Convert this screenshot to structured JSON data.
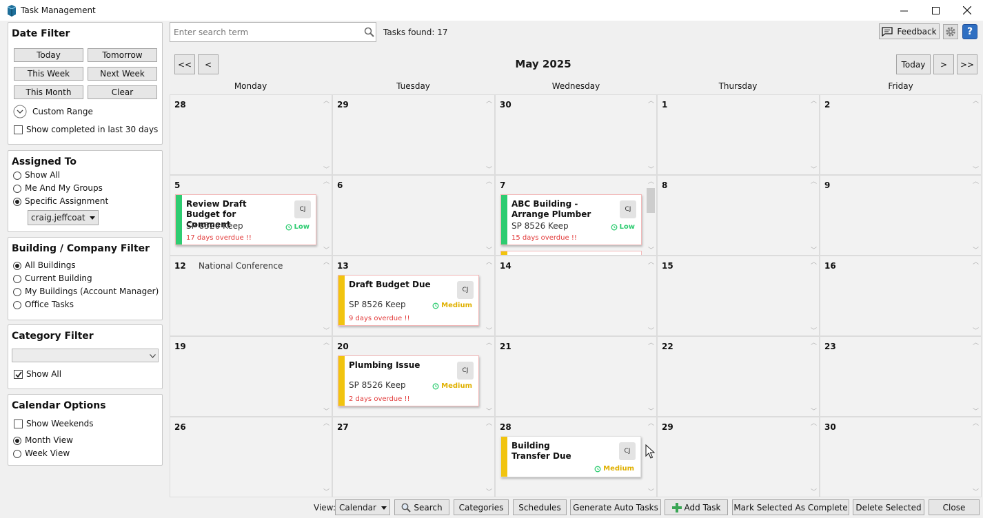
{
  "window": {
    "title": "Task Management"
  },
  "colors": {
    "low": "#2ecc71",
    "medium": "#f1c40f",
    "overdue": "#e23b3b"
  },
  "date_filter": {
    "title": "Date Filter",
    "today": "Today",
    "tomorrow": "Tomorrow",
    "this_week": "This Week",
    "next_week": "Next Week",
    "this_month": "This Month",
    "clear": "Clear",
    "custom_range": "Custom Range",
    "show_completed": "Show completed in last 30 days"
  },
  "assigned": {
    "title": "Assigned To",
    "options": [
      "Show All",
      "Me And My Groups",
      "Specific Assignment"
    ],
    "selected_user": "craig.jeffcoat"
  },
  "building": {
    "title": "Building / Company Filter",
    "options": [
      "All Buildings",
      "Current Building",
      "My Buildings (Account Manager)",
      "Office Tasks"
    ]
  },
  "category": {
    "title": "Category Filter",
    "show_all": "Show All"
  },
  "calendar_options": {
    "title": "Calendar Options",
    "show_weekends": "Show Weekends",
    "month_view": "Month View",
    "week_view": "Week View"
  },
  "search": {
    "placeholder": "Enter search term",
    "tasks_found": "Tasks found: 17"
  },
  "header": {
    "feedback": "Feedback"
  },
  "nav": {
    "first": "<<",
    "prev": "<",
    "month": "May 2025",
    "today": "Today",
    "next": ">",
    "last": ">>"
  },
  "days": [
    "Monday",
    "Tuesday",
    "Wednesday",
    "Thursday",
    "Friday"
  ],
  "weeks": [
    [
      "28",
      "29",
      "30",
      "1",
      "2"
    ],
    [
      "5",
      "6",
      "7",
      "8",
      "9"
    ],
    [
      "12",
      "13",
      "14",
      "15",
      "16"
    ],
    [
      "19",
      "20",
      "21",
      "22",
      "23"
    ],
    [
      "26",
      "27",
      "28",
      "29",
      "30"
    ]
  ],
  "holiday": "National Conference",
  "tasks": [
    {
      "title": "Review Draft Budget for Comment",
      "location": "SP 8526 Keep",
      "overdue": "17 days overdue !!",
      "assignee": "CJ",
      "priority": "Low"
    },
    {
      "title": "ABC Building - Arrange Plumber",
      "location": "SP 8526 Keep",
      "overdue": "15 days overdue !!",
      "assignee": "CJ",
      "priority": "Low"
    },
    {
      "title": "Draft Budget Due",
      "location": "SP 8526 Keep",
      "overdue": "9 days overdue !!",
      "assignee": "CJ",
      "priority": "Medium"
    },
    {
      "title": "Plumbing Issue",
      "location": "SP 8526 Keep",
      "overdue": "2 days overdue !!",
      "assignee": "CJ",
      "priority": "Medium"
    },
    {
      "title": "Building Transfer Due",
      "assignee": "CJ",
      "priority": "Medium"
    }
  ],
  "bottom": {
    "view_label": "View:",
    "view_value": "Calendar",
    "search": "Search",
    "categories": "Categories",
    "schedules": "Schedules",
    "generate": "Generate Auto Tasks",
    "add_task": "Add Task",
    "mark_complete": "Mark Selected As Complete",
    "delete": "Delete Selected",
    "close": "Close"
  }
}
